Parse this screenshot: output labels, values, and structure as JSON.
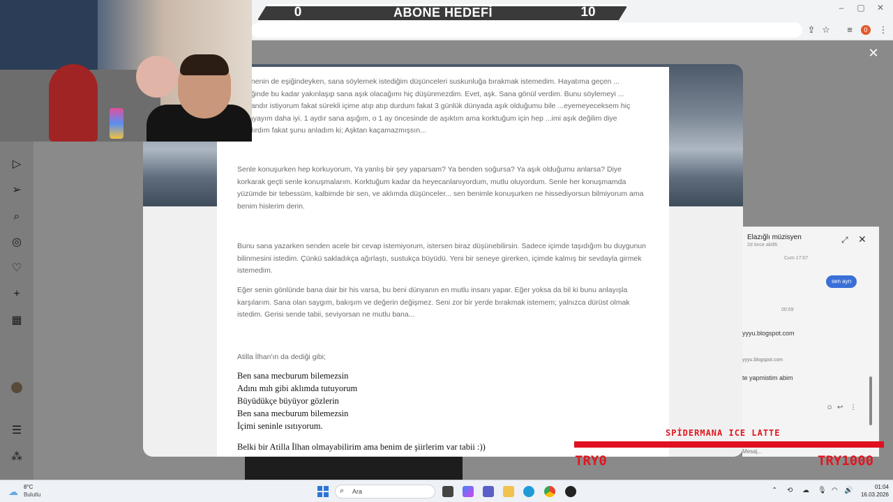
{
  "overlay": {
    "goal_left": "0",
    "goal_title": "ABONE HEDEFİ",
    "goal_right": "10",
    "donation_title": "SPİDERMANA ICE LATTE",
    "donation_left": "TRY0",
    "donation_right": "TRY1000",
    "donation_color": "#e0161f"
  },
  "browser": {
    "profile_badge": "0"
  },
  "letter": {
    "p1": "...senenin de eşiğindeyken, sana söylemek istediğim düşünceleri suskunluğa bırakmak istemedim. Hayatıma geçen ... girdiğinde bu kadar yakınlaşıp sana aşık olacağımı hiç düşünmezdim. Evet, aşk. Sana gönül verdim. Bunu söylemeyi ... zamandır istiyorum fakat sürekli içime atıp atıp durdum fakat 3 günlük dünyada aşık olduğumu bile ...eyemeyeceksem hiç olmayayım daha iyi. 1 aydır sana aşığım, o 1 ay öncesinde de aşıktım ama korktuğum için hep ...imi aşık değilim diye kandırdım fakat şunu anladım ki; Aşktan kaçamazmışsın...",
    "p2": "Senle konuşurken hep korkuyorum, Ya yanlış bir şey yaparsam? Ya benden soğursa? Ya aşık olduğumu anlarsa? Diye korkarak geçti senle konuşmalarım. Korktuğum kadar da heyecanlanıyordum, mutlu oluyordum. Senle her konuşmamda yüzümde bir tebessüm, kalbimde bir sen, ve aklımda düşünceler... sen benimle konuşurken ne hissediyorsun bilmiyorum ama benim hislerim derin.",
    "p3": "Bunu sana yazarken senden acele bir cevap istemiyorum, istersen biraz düşünebilirsin. Sadece içimde taşıdığım bu duygunun bilinmesini istedim. Çünkü sakladıkça ağırlaştı, sustukça büyüdü. Yeni bir seneye girerken, içimde kalmış bir sevdayla girmek istemedim.",
    "p4": "Eğer senin gönlünde bana dair bir his varsa, bu beni dünyanın en mutlu insanı yapar. Eğer yoksa da bil ki bunu anlayışla karşılarım. Sana olan saygım, bakışım ve değerin değişmez. Seni zor bir yerde bırakmak istemem; yalnızca dürüst olmak istedim. Gerisi sende tabii, seviyorsan ne mutlu bana...",
    "quote_intro": "Atilla İlhan'ın da dediği gibi;",
    "poem": [
      "Ben sana mecburum bilemezsin",
      "Adını mıh gibi aklımda tutuyorum",
      "Büyüdükçe büyüyor gözlerin",
      "Ben sana mecburum bilemezsin",
      "İçimi seninle ısıtıyorum."
    ],
    "closing": "Belki bir Atilla İlhan olmayabilirim ama benim de şiirlerim var tabii :))"
  },
  "chat": {
    "name": "Elazığlı müzisyen",
    "status": "2d önce aktifti",
    "time1": "Cum 17:07",
    "bubble": "sen ayrı",
    "time2": "00:59",
    "link": "yyyu.blogspot.com",
    "link2": "yyyu.blogspot.com",
    "msg": "te yapmistim abim",
    "input_hint": "Mesaj..."
  },
  "taskbar": {
    "weather_temp": "8°C",
    "weather_desc": "Bulutlu",
    "search_text": "Ara",
    "time": "01:04",
    "date": "16.03.2026"
  }
}
